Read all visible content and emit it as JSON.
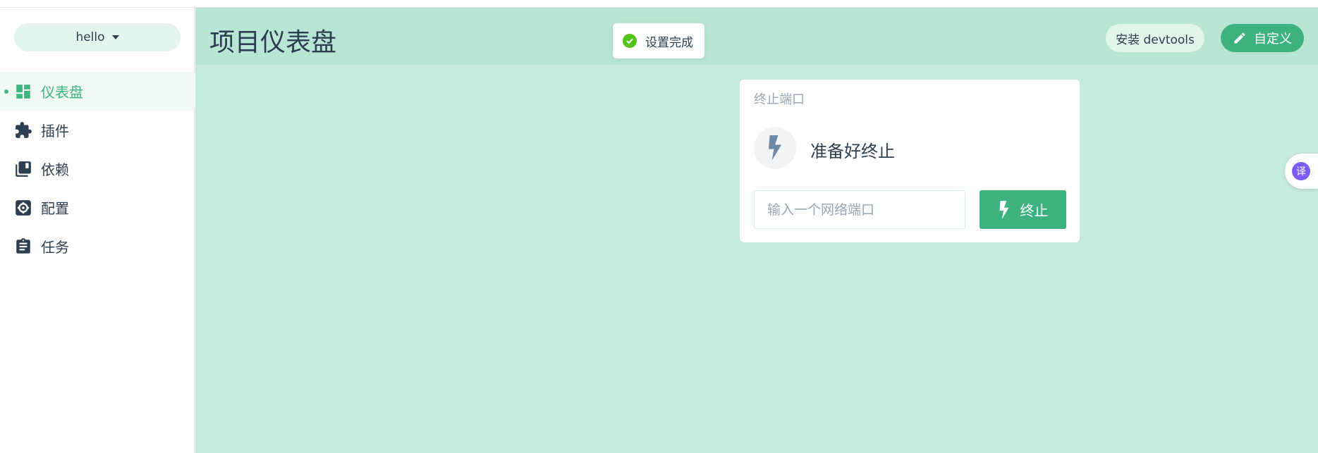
{
  "colors": {
    "accent": "#3cb37f",
    "main_bg": "#c6eadd",
    "header_bg": "#b9e5d4",
    "text": "#2c3e50",
    "muted": "#9aa5b0",
    "success": "#52c41a",
    "translate": "#7c5cf5"
  },
  "sidebar": {
    "project_name": "hello",
    "items": [
      {
        "label": "仪表盘",
        "icon": "dashboard-icon",
        "active": true
      },
      {
        "label": "插件",
        "icon": "puzzle-icon",
        "active": false
      },
      {
        "label": "依赖",
        "icon": "library-books-icon",
        "active": false
      },
      {
        "label": "配置",
        "icon": "settings-icon",
        "active": false
      },
      {
        "label": "任务",
        "icon": "clipboard-icon",
        "active": false
      }
    ]
  },
  "header": {
    "title": "项目仪表盘",
    "devtools_label": "安装 devtools",
    "customize_label": "自定义"
  },
  "toast": {
    "message": "设置完成"
  },
  "kill_port_widget": {
    "title": "终止端口",
    "status_text": "准备好终止",
    "input_placeholder": "输入一个网络端口",
    "input_value": "",
    "button_label": "终止"
  },
  "translate_badge": {
    "label": "译"
  }
}
